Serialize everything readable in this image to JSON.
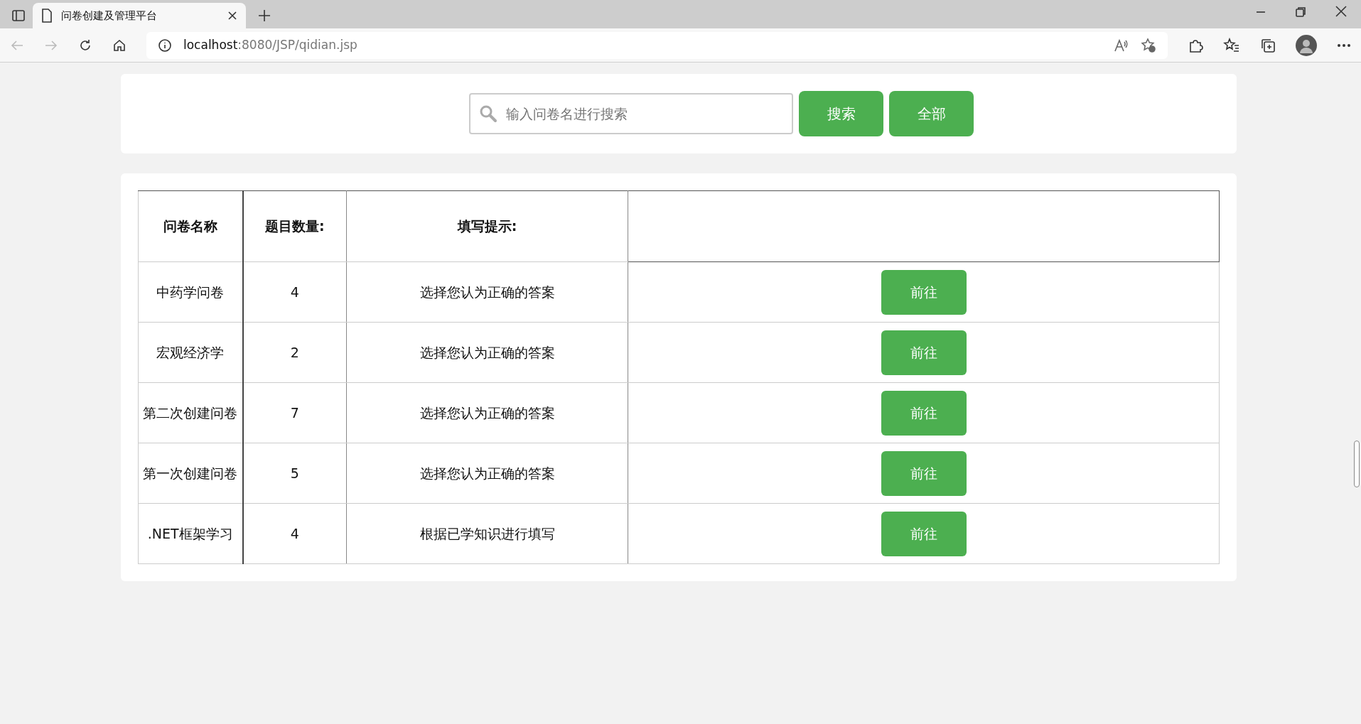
{
  "browser": {
    "tab_title": "问卷创建及管理平台",
    "address_host": "localhost",
    "address_path": ":8080/JSP/qidian.jsp"
  },
  "search": {
    "placeholder": "输入问卷名进行搜索",
    "buttons": [
      "搜索",
      "全部"
    ]
  },
  "table": {
    "columns": [
      "问卷名称",
      "题目数量:",
      "填写提示:"
    ],
    "rows": [
      {
        "name": "中药学问卷",
        "count": "4",
        "hint": "选择您认为正确的答案",
        "action": "前往"
      },
      {
        "name": "宏观经济学",
        "count": "2",
        "hint": "选择您认为正确的答案",
        "action": "前往"
      },
      {
        "name": "第二次创建问卷",
        "count": "7",
        "hint": "选择您认为正确的答案",
        "action": "前往"
      },
      {
        "name": "第一次创建问卷",
        "count": "5",
        "hint": "选择您认为正确的答案",
        "action": "前往"
      },
      {
        "name": ".NET框架学习",
        "count": "4",
        "hint": "根据已学知识进行填写",
        "action": "前往"
      }
    ]
  }
}
